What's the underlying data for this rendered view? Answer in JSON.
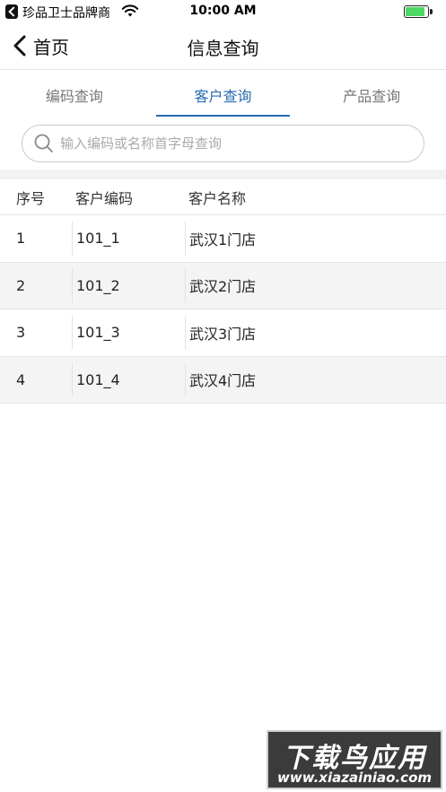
{
  "status_bar": {
    "carrier": "珍品卫士品牌商",
    "time": "10:00 AM",
    "battery_level": 0.9
  },
  "nav": {
    "back_label": "首页",
    "title": "信息查询"
  },
  "tabs": [
    {
      "label": "编码查询",
      "active": false
    },
    {
      "label": "客户查询",
      "active": true
    },
    {
      "label": "产品查询",
      "active": false
    }
  ],
  "search": {
    "placeholder": "输入编码或名称首字母查询",
    "value": ""
  },
  "table": {
    "headers": [
      "序号",
      "客户编码",
      "客户名称"
    ],
    "rows": [
      [
        "1",
        "101_1",
        "武汉1门店"
      ],
      [
        "2",
        "101_2",
        "武汉2门店"
      ],
      [
        "3",
        "101_3",
        "武汉3门店"
      ],
      [
        "4",
        "101_4",
        "武汉4门店"
      ]
    ]
  },
  "watermark": {
    "main": "下载鸟应用",
    "sub": "www.xiazainiao.com"
  },
  "colors": {
    "accent": "#2a6bb0",
    "battery": "#4cd964",
    "row_alt": "#f4f4f4"
  },
  "icons": {
    "back": "chevron-left-icon",
    "search": "search-icon",
    "wifi": "wifi-icon",
    "battery": "battery-icon"
  }
}
